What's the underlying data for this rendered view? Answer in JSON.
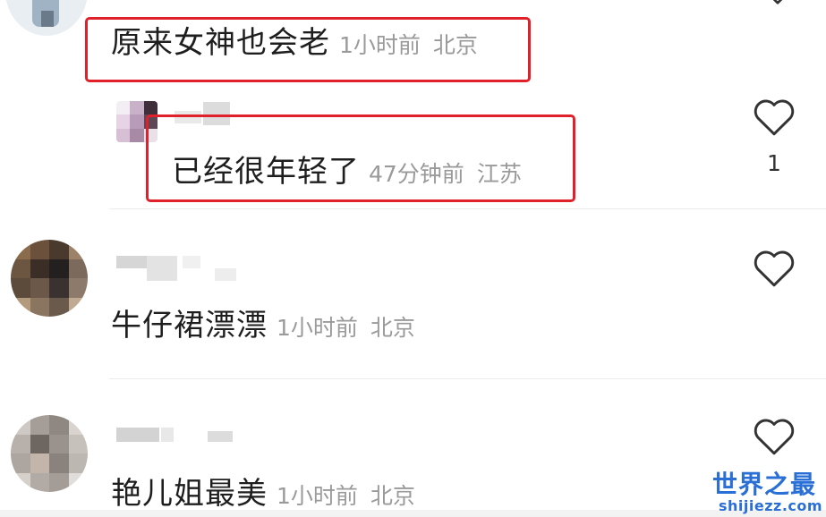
{
  "comments": [
    {
      "text": "原来女神也会老",
      "time": "1小时前",
      "location": "北京"
    },
    {
      "text": "已经很年轻了",
      "time": "47分钟前",
      "location": "江苏",
      "likes": "1"
    },
    {
      "text": "牛仔裙漂漂",
      "time": "1小时前",
      "location": "北京"
    },
    {
      "text": "艳儿姐最美",
      "time": "1小时前",
      "location": "北京"
    }
  ],
  "watermark": {
    "title": "世界之最",
    "domain": "shijiezz.com"
  },
  "colors": {
    "highlight_box": "#e0212b",
    "meta_text": "#9a9a9a",
    "watermark": "#2a6fd6"
  }
}
